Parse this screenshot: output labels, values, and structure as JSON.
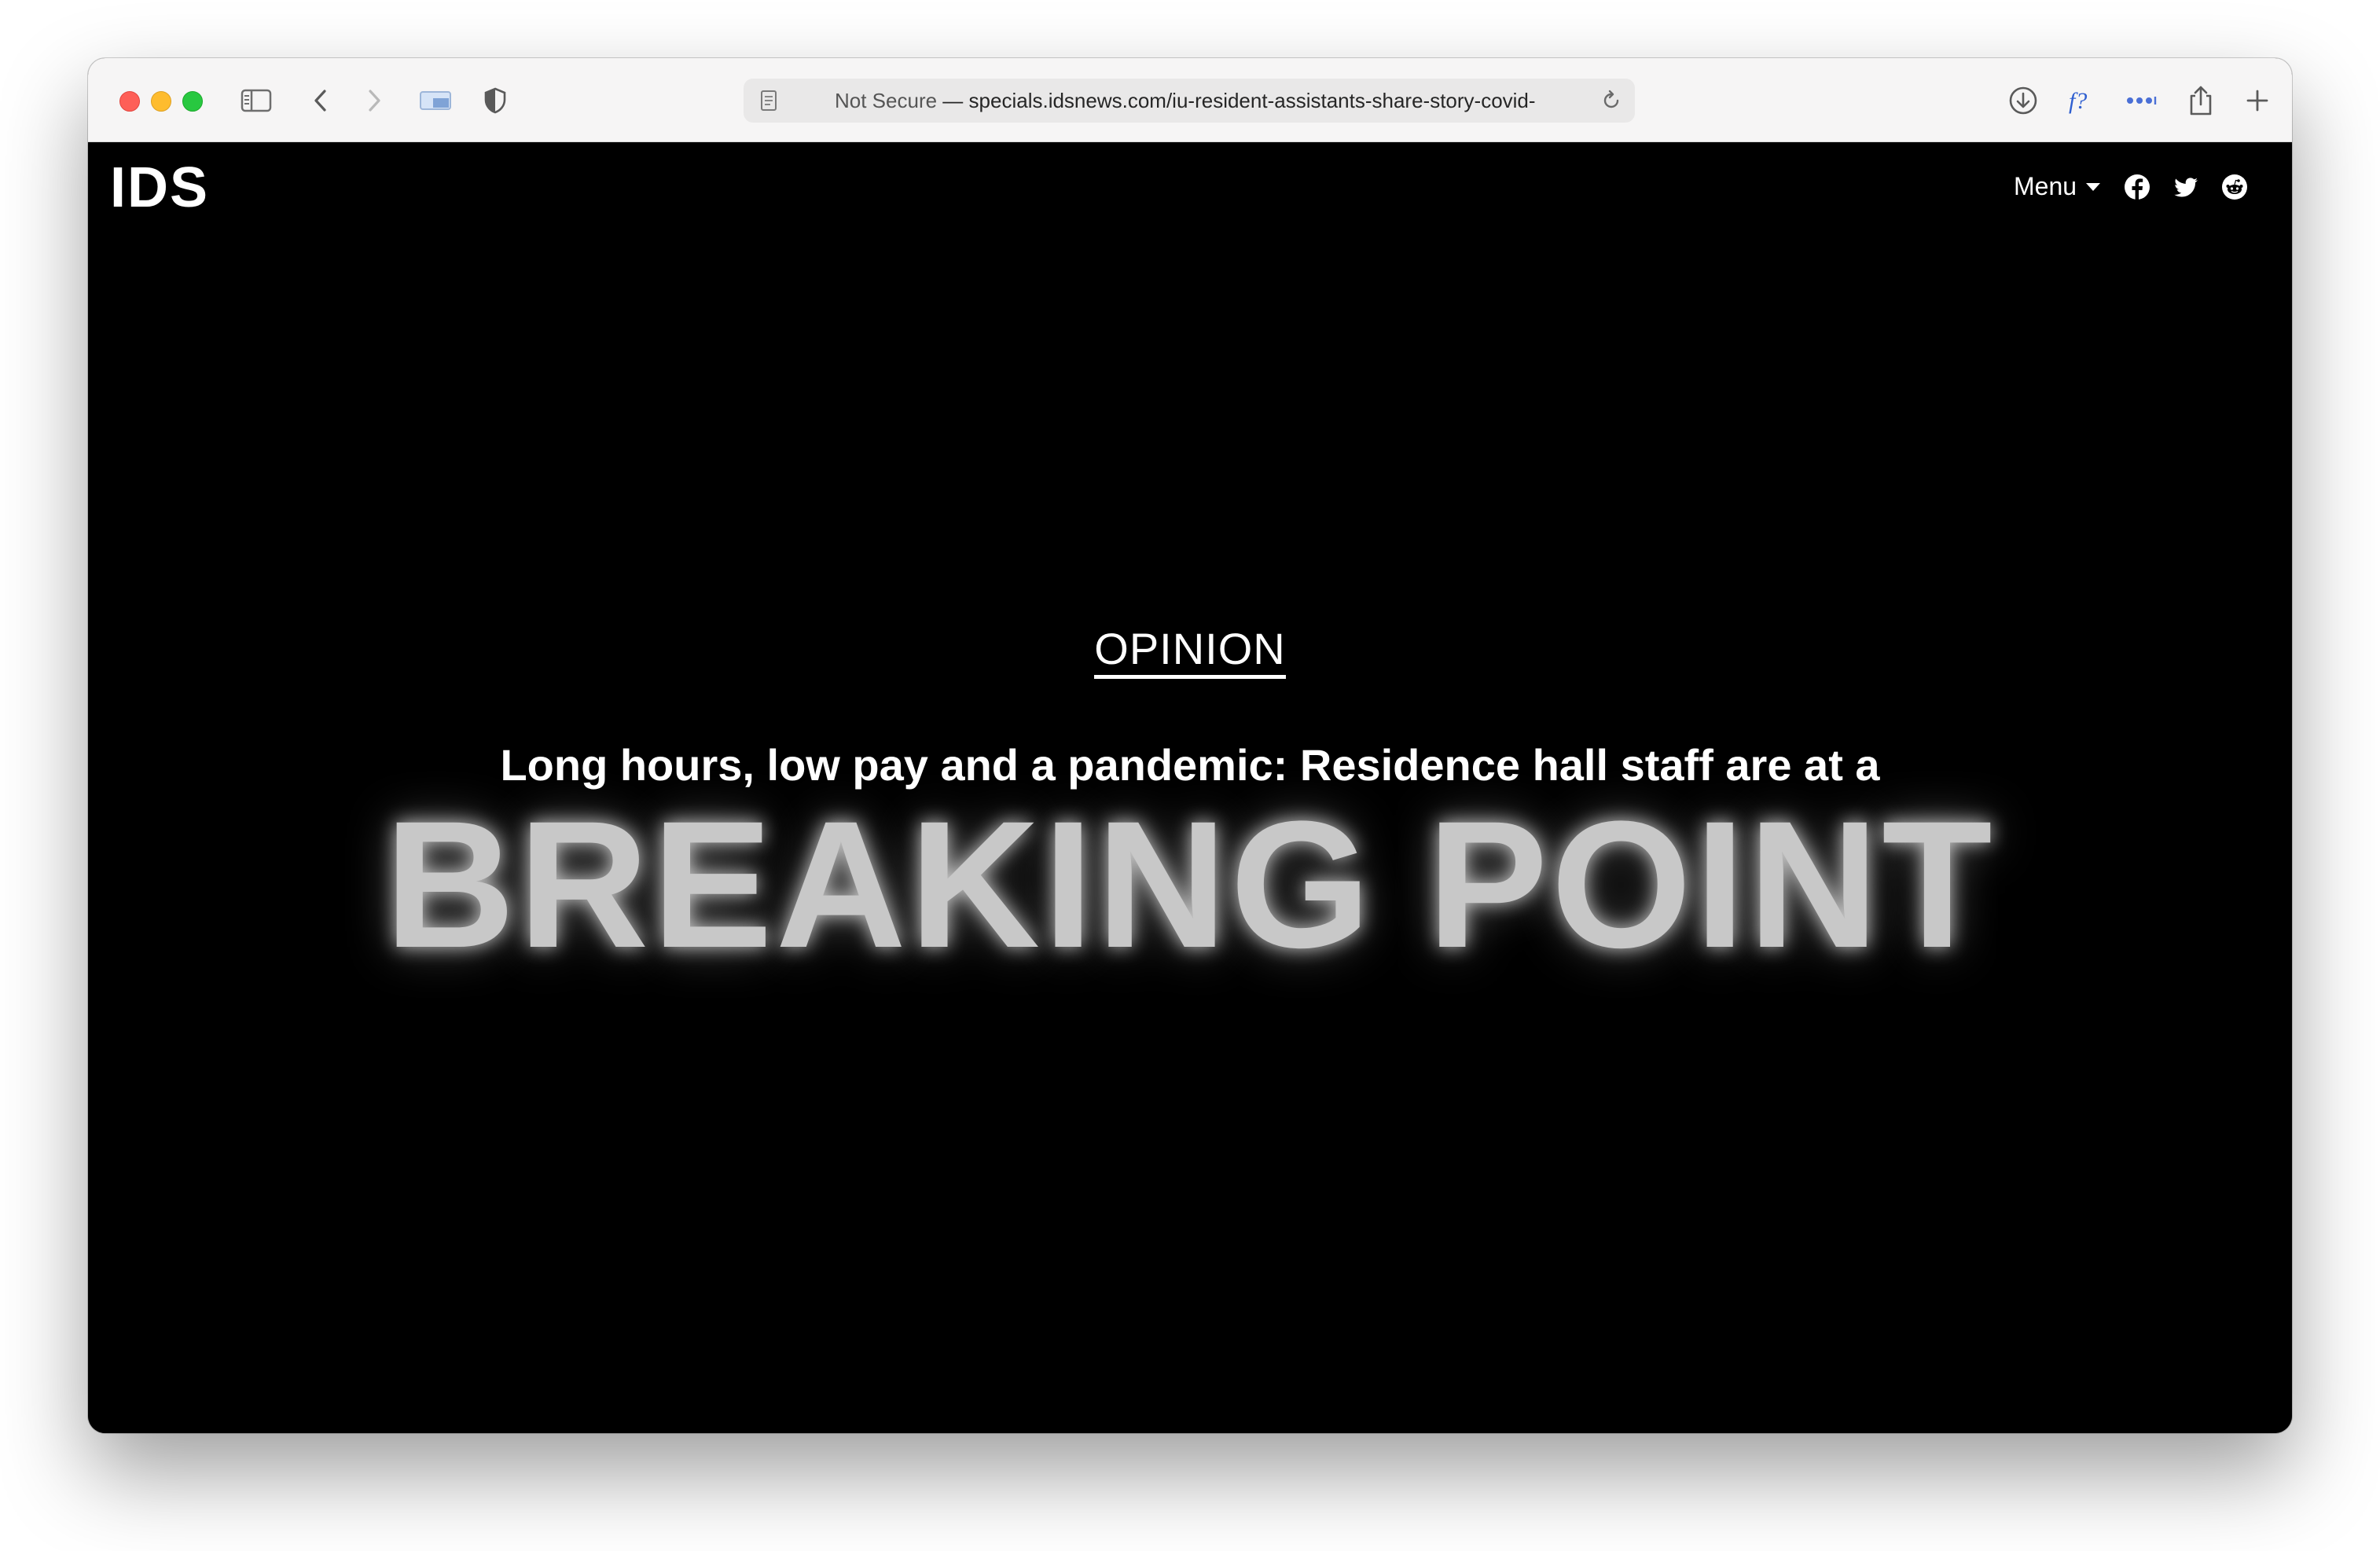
{
  "browser": {
    "url_security": "Not Secure",
    "url_separator": " — ",
    "url_address": "specials.idsnews.com/iu-resident-assistants-share-story-covid-"
  },
  "site": {
    "logo": "IDS",
    "menu_label": "Menu",
    "social_icons": [
      "facebook-icon",
      "twitter-icon",
      "reddit-icon"
    ]
  },
  "article": {
    "section": "OPINION",
    "subtitle": "Long hours, low pay and a pandemic: Residence hall staff are at a",
    "headline": "BREAKING POINT"
  },
  "colors": {
    "page_background": "#000000",
    "headline_text": "#c8c8c8",
    "text": "#ffffff"
  }
}
